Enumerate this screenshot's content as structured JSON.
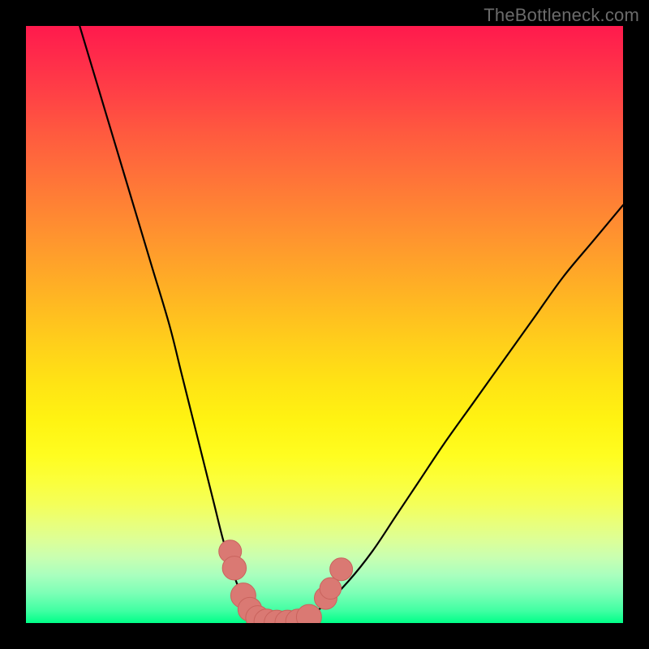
{
  "watermark": {
    "text": "TheBottleneck.com"
  },
  "colors": {
    "background": "#000000",
    "curve_stroke": "#000000",
    "marker_fill": "#da7973",
    "marker_stroke": "#c9635d"
  },
  "chart_data": {
    "type": "line",
    "title": "",
    "xlabel": "",
    "ylabel": "",
    "xlim": [
      0,
      100
    ],
    "ylim": [
      0,
      100
    ],
    "grid": false,
    "legend": false,
    "annotations": [
      "TheBottleneck.com"
    ],
    "series": [
      {
        "name": "bottleneck-curve",
        "x": [
          9,
          12,
          15,
          18,
          21,
          24,
          26,
          28,
          30,
          31.5,
          33,
          34.5,
          36,
          37.5,
          39,
          41,
          43,
          45,
          47,
          50,
          54,
          58,
          62,
          66,
          70,
          75,
          80,
          85,
          90,
          95,
          100
        ],
        "y": [
          100,
          90,
          80,
          70,
          60,
          50,
          42,
          34,
          26,
          20,
          14,
          9,
          5,
          2.5,
          1,
          0.2,
          0,
          0.2,
          1,
          3,
          7,
          12,
          18,
          24,
          30,
          37,
          44,
          51,
          58,
          64,
          70
        ]
      }
    ],
    "markers": [
      {
        "x": 34.2,
        "y": 12.0,
        "r": 1.9
      },
      {
        "x": 34.9,
        "y": 9.2,
        "r": 2.0
      },
      {
        "x": 36.4,
        "y": 4.6,
        "r": 2.1
      },
      {
        "x": 37.5,
        "y": 2.3,
        "r": 2.0
      },
      {
        "x": 38.8,
        "y": 0.9,
        "r": 2.0
      },
      {
        "x": 40.3,
        "y": 0.25,
        "r": 2.1
      },
      {
        "x": 42.0,
        "y": 0.05,
        "r": 2.1
      },
      {
        "x": 43.8,
        "y": 0.05,
        "r": 2.1
      },
      {
        "x": 45.6,
        "y": 0.25,
        "r": 2.1
      },
      {
        "x": 47.4,
        "y": 1.0,
        "r": 2.1
      },
      {
        "x": 50.2,
        "y": 4.2,
        "r": 1.9
      },
      {
        "x": 51.0,
        "y": 5.8,
        "r": 1.8
      },
      {
        "x": 52.8,
        "y": 9.0,
        "r": 1.9
      }
    ]
  }
}
